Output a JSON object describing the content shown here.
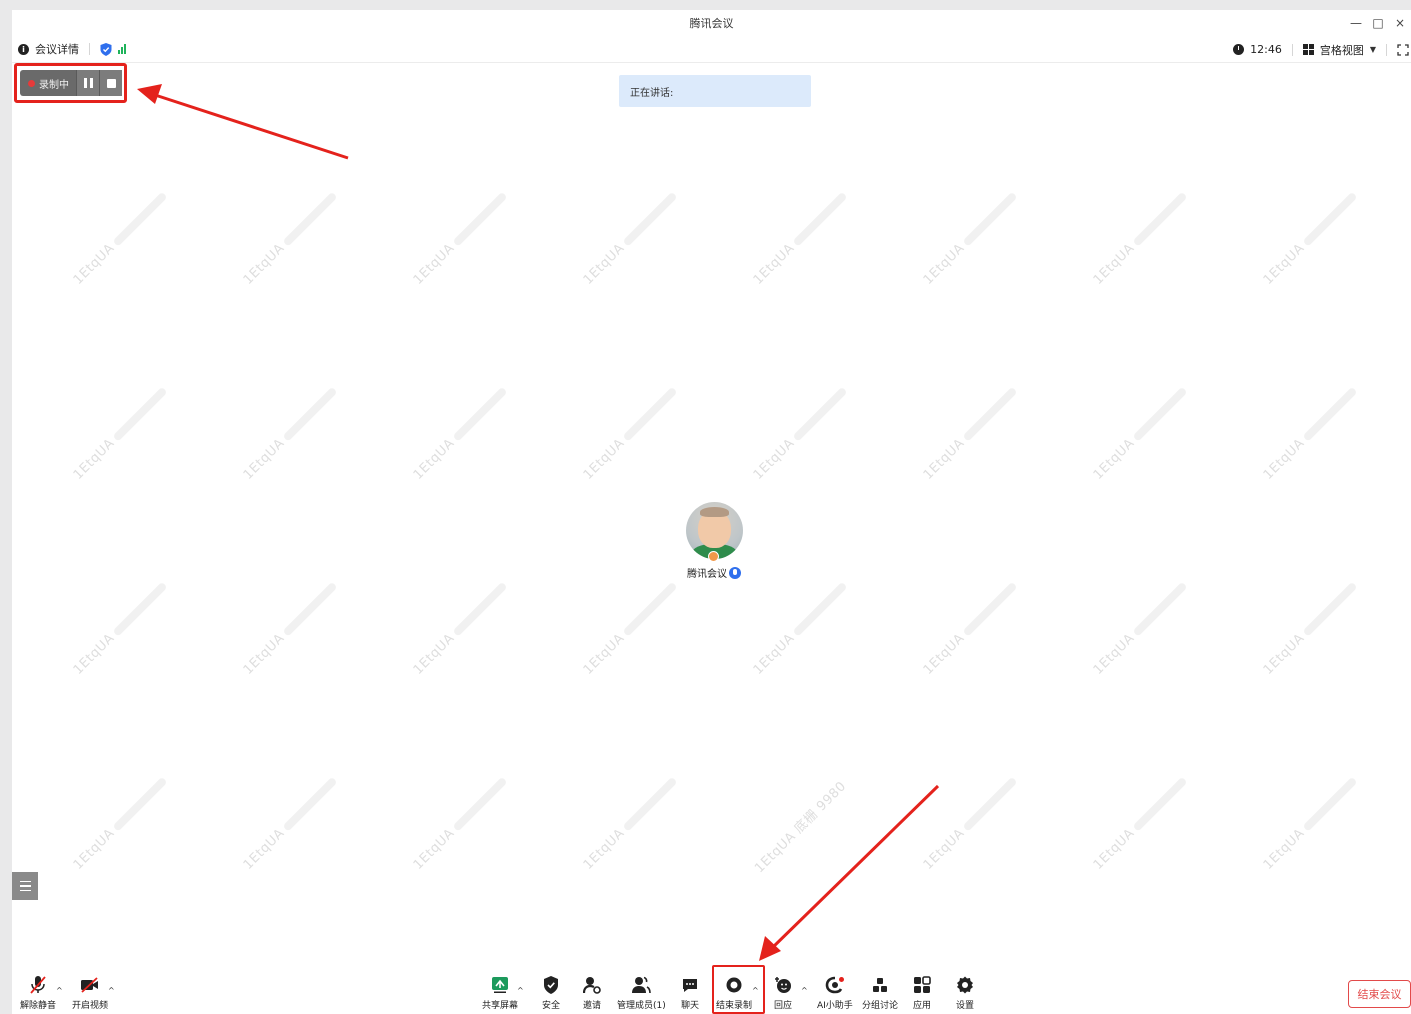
{
  "window": {
    "title": "腾讯会议"
  },
  "window_controls": {
    "minimize": "—",
    "maximize": "□",
    "close": "×"
  },
  "infobar": {
    "meeting_details": "会议详情",
    "time": "12:46",
    "view_mode": "宫格视图"
  },
  "recording": {
    "status": "录制中"
  },
  "speaking": {
    "label": "正在讲话:"
  },
  "watermark": {
    "text": "1EtqUA",
    "extra": "1EtqUA 底栅 9980"
  },
  "participant": {
    "name": "腾讯会议"
  },
  "toolbar": {
    "unmute": "解除静音",
    "start_video": "开启视频",
    "share_screen": "共享屏幕",
    "security": "安全",
    "invite": "邀请",
    "manage_members": "管理成员(1)",
    "chat": "聊天",
    "end_recording": "结束录制",
    "reactions": "回应",
    "ai_assistant": "AI小助手",
    "breakout": "分组讨论",
    "apps": "应用",
    "settings": "设置"
  },
  "end_meeting": "结束会议",
  "colors": {
    "highlight_red": "#e4221c",
    "speaking_bg": "#dceafb",
    "signal_green": "#1fb35b",
    "end_meeting_red": "#e24a4a",
    "share_green": "#1c9a5c"
  }
}
